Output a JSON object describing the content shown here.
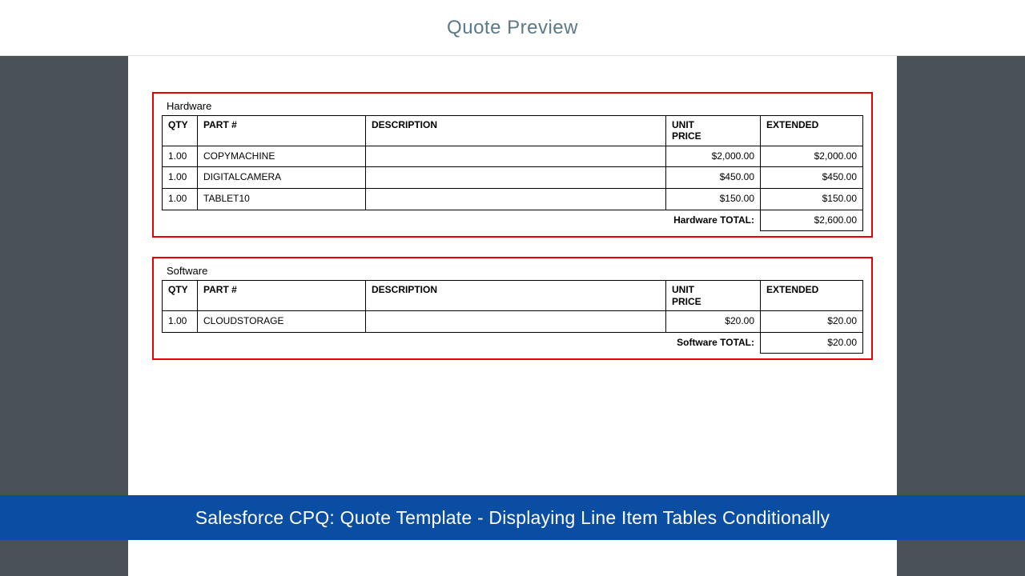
{
  "header": {
    "title": "Quote Preview"
  },
  "columns": {
    "qty": "QTY",
    "part": "PART #",
    "desc": "DESCRIPTION",
    "unit": "UNIT PRICE",
    "ext": "EXTENDED"
  },
  "sections": [
    {
      "name": "Hardware",
      "rows": [
        {
          "qty": "1.00",
          "part": "COPYMACHINE",
          "desc": "",
          "unit": "$2,000.00",
          "ext": "$2,000.00"
        },
        {
          "qty": "1.00",
          "part": "DIGITALCAMERA",
          "desc": "",
          "unit": "$450.00",
          "ext": "$450.00"
        },
        {
          "qty": "1.00",
          "part": "TABLET10",
          "desc": "",
          "unit": "$150.00",
          "ext": "$150.00"
        }
      ],
      "total_label": "Hardware TOTAL:",
      "total_value": "$2,600.00"
    },
    {
      "name": "Software",
      "rows": [
        {
          "qty": "1.00",
          "part": "CLOUDSTORAGE",
          "desc": "",
          "unit": "$20.00",
          "ext": "$20.00"
        }
      ],
      "total_label": "Software TOTAL:",
      "total_value": "$20.00"
    }
  ],
  "banner": {
    "text": "Salesforce CPQ: Quote Template - Displaying Line Item Tables Conditionally"
  }
}
